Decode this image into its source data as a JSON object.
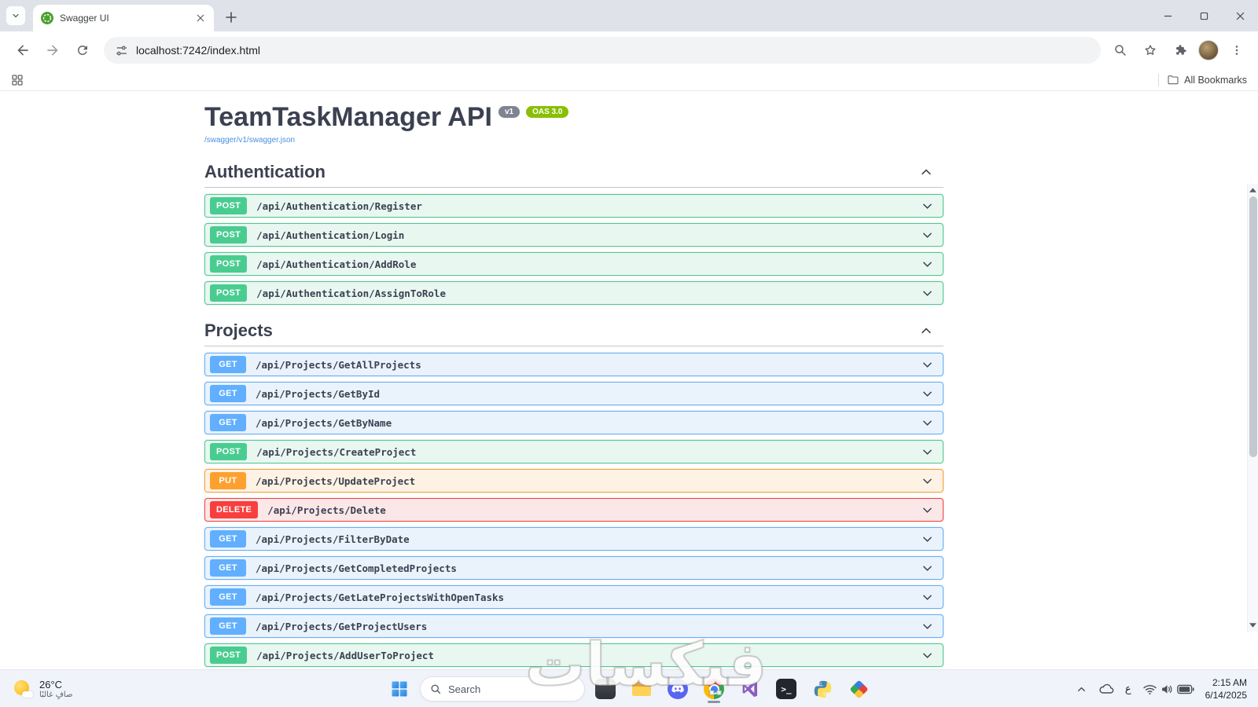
{
  "browser": {
    "tab_title": "Swagger UI",
    "url": "localhost:7242/index.html",
    "all_bookmarks_label": "All Bookmarks"
  },
  "swagger": {
    "title": "TeamTaskManager API",
    "version_badge": "v1",
    "oas_badge": "OAS 3.0",
    "spec_link": "/swagger/v1/swagger.json",
    "sections": [
      {
        "name": "Authentication",
        "expanded": true,
        "endpoints": [
          {
            "method": "POST",
            "path": "/api/Authentication/Register"
          },
          {
            "method": "POST",
            "path": "/api/Authentication/Login"
          },
          {
            "method": "POST",
            "path": "/api/Authentication/AddRole"
          },
          {
            "method": "POST",
            "path": "/api/Authentication/AssignToRole"
          }
        ]
      },
      {
        "name": "Projects",
        "expanded": true,
        "endpoints": [
          {
            "method": "GET",
            "path": "/api/Projects/GetAllProjects"
          },
          {
            "method": "GET",
            "path": "/api/Projects/GetById"
          },
          {
            "method": "GET",
            "path": "/api/Projects/GetByName"
          },
          {
            "method": "POST",
            "path": "/api/Projects/CreateProject"
          },
          {
            "method": "PUT",
            "path": "/api/Projects/UpdateProject"
          },
          {
            "method": "DELETE",
            "path": "/api/Projects/Delete"
          },
          {
            "method": "GET",
            "path": "/api/Projects/FilterByDate"
          },
          {
            "method": "GET",
            "path": "/api/Projects/GetCompletedProjects"
          },
          {
            "method": "GET",
            "path": "/api/Projects/GetLateProjectsWithOpenTasks"
          },
          {
            "method": "GET",
            "path": "/api/Projects/GetProjectUsers"
          },
          {
            "method": "POST",
            "path": "/api/Projects/AddUserToProject"
          }
        ]
      }
    ]
  },
  "method_colors": {
    "GET": {
      "badge": "#61affe",
      "border": "#61affe",
      "bg": "#eaf3fc"
    },
    "POST": {
      "badge": "#49cc90",
      "border": "#49cc90",
      "bg": "#e9f7f1"
    },
    "PUT": {
      "badge": "#fca130",
      "border": "#fca130",
      "bg": "#fdf2e4"
    },
    "DELETE": {
      "badge": "#f93e3e",
      "border": "#f93e3e",
      "bg": "#fbe7e7"
    }
  },
  "colors": {
    "version_badge": "#7d8492",
    "oas_badge": "#89bf04",
    "link_blue": "#4990e2"
  },
  "taskbar": {
    "weather_temp": "26°C",
    "weather_desc": "صافٍ غالبًا",
    "search_label": "Search",
    "language_indicator": "ع",
    "clock_time": "2:15 AM",
    "clock_date": "6/14/2025"
  },
  "watermark_text": "فيكسات"
}
